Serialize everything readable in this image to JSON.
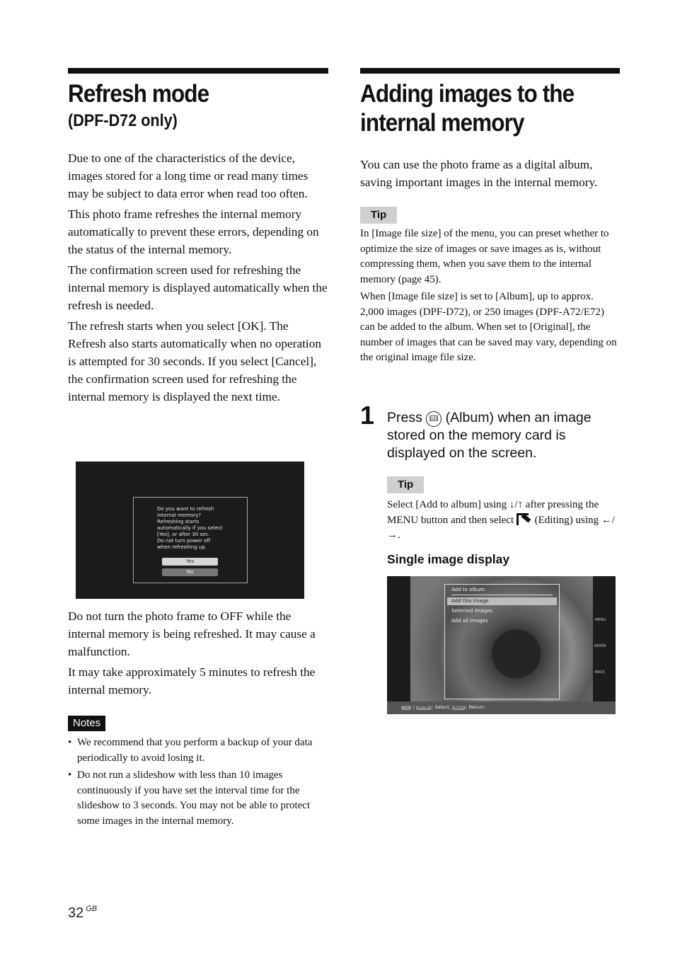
{
  "left": {
    "title": "Refresh mode",
    "subtitle": "(DPF-D72 only)",
    "paragraphs": [
      "Due to one of the characteristics of the device, images stored for a long time or read many times may be subject to data error when read too often.",
      "This photo frame refreshes the internal memory automatically to prevent these errors, depending on the status of the internal memory.",
      "The confirmation screen used for refreshing the internal memory is displayed automatically when the refresh is needed.",
      "The refresh starts when you select [OK]. The Refresh also starts automatically when no operation is attempted for 30 seconds. If you select [Cancel], the confirmation screen used for refreshing the internal memory is displayed the next time."
    ],
    "screen": {
      "message": "Do you want to refresh\ninternal memory?\nRefreshing starts\nautomatically if you select\n[Yes], or after 30 sec.\nDo not turn power off\nwhen refreshing up.",
      "yes_label": "Yes",
      "no_label": "No"
    },
    "paragraphs_after": [
      "Do not turn the photo frame to OFF while the internal memory is being refreshed. It may cause a malfunction.",
      "It may take approximately 5 minutes to refresh the internal memory."
    ],
    "notes_label": "Notes",
    "notes": [
      "We recommend that you perform a backup of your data periodically to avoid losing it.",
      "Do not run a slideshow with less than 10 images continuously if you have set the interval time for the slideshow to 3 seconds. You may not be able to protect some images in the internal memory."
    ]
  },
  "right": {
    "title_line1": "Adding images to the",
    "title_line2": "internal memory",
    "intro": "You can use the photo frame as a digital album, saving important images in the internal memory.",
    "tip_label": "Tip",
    "tip_paragraphs": [
      "In [Image file size] of the menu, you can preset whether to optimize the size of images or save images as is, without compressing them, when you save them to the internal memory (page 45).",
      "When [Image file size] is set to [Album], up to approx. 2,000 images (DPF-D72), or 250 images (DPF-A72/E72) can be added to the album. When set to [Original], the number of images that can be saved may vary, depending on the original image file size."
    ],
    "step_number": "1",
    "step_pre": "Press ",
    "step_icon": "album-icon",
    "step_post": " (Album) when an image stored on the memory card is displayed on the screen.",
    "tip2_label": "Tip",
    "tip2_part1": "Select [Add to album] using ↓/↑ after pressing the MENU button and  then select ",
    "tip2_icon": "editing-icon",
    "tip2_part2": " (Editing) using ←/→.",
    "subhead": "Single image display",
    "screen": {
      "menu_title": "Add to album",
      "menu_items": [
        "Add this image",
        "Selected images",
        "Add all images"
      ],
      "selected_index": 0,
      "side_labels": [
        "MENU",
        "ENTER",
        "BACK"
      ],
      "bottom_keys": [
        "↑↓",
        "ENTER",
        "BACK"
      ],
      "bottom_select": ": Select, ",
      "bottom_return": ": Return."
    }
  },
  "footer": {
    "page_number": "32",
    "region": "GB"
  }
}
